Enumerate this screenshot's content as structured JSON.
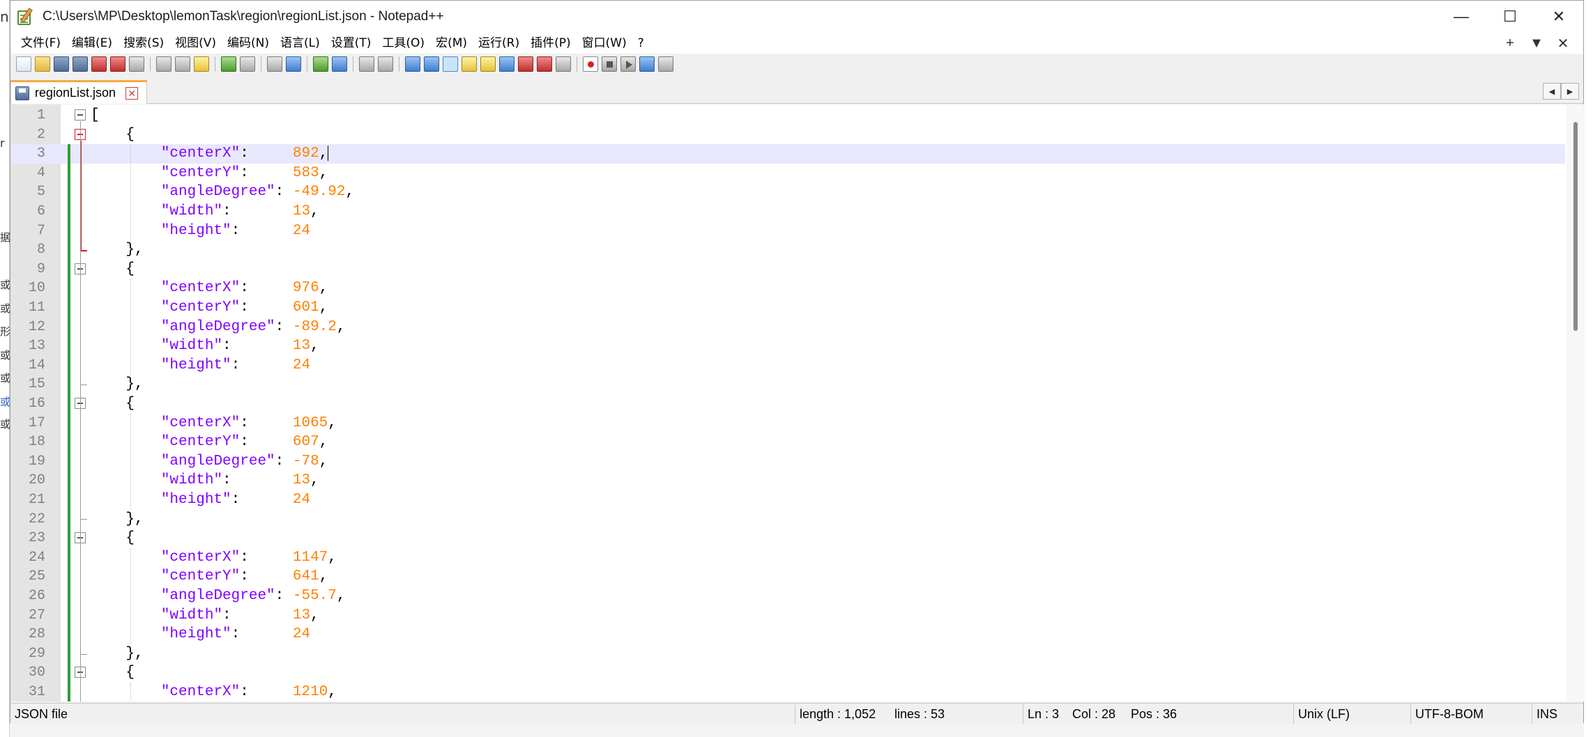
{
  "window": {
    "title": "C:\\Users\\MP\\Desktop\\lemonTask\\region\\regionList.json - Notepad++",
    "controls": {
      "minimize": "—",
      "maximize": "☐",
      "close": "✕"
    }
  },
  "menu": {
    "items": [
      "文件(F)",
      "编辑(E)",
      "搜索(S)",
      "视图(V)",
      "编码(N)",
      "语言(L)",
      "设置(T)",
      "工具(O)",
      "宏(M)",
      "运行(R)",
      "插件(P)",
      "窗口(W)",
      "?"
    ],
    "right": {
      "add": "+",
      "dropdown": "▼",
      "close": "✕"
    }
  },
  "tab": {
    "label": "regionList.json",
    "close": "✕"
  },
  "tab_scroll": {
    "left": "◀",
    "right": "▶"
  },
  "editor": {
    "current_line": 3,
    "lines": [
      {
        "n": "1",
        "tokens": [
          [
            "pun",
            "["
          ]
        ]
      },
      {
        "n": "2",
        "tokens": [
          [
            "pun",
            "    {"
          ]
        ]
      },
      {
        "n": "3",
        "tokens": [
          [
            "pun",
            "        "
          ],
          [
            "key",
            "\"centerX\""
          ],
          [
            "pun",
            ":     "
          ],
          [
            "num",
            "892"
          ],
          [
            "pun",
            ","
          ]
        ]
      },
      {
        "n": "4",
        "tokens": [
          [
            "pun",
            "        "
          ],
          [
            "key",
            "\"centerY\""
          ],
          [
            "pun",
            ":     "
          ],
          [
            "num",
            "583"
          ],
          [
            "pun",
            ","
          ]
        ]
      },
      {
        "n": "5",
        "tokens": [
          [
            "pun",
            "        "
          ],
          [
            "key",
            "\"angleDegree\""
          ],
          [
            "pun",
            ": "
          ],
          [
            "num",
            "-49.92"
          ],
          [
            "pun",
            ","
          ]
        ]
      },
      {
        "n": "6",
        "tokens": [
          [
            "pun",
            "        "
          ],
          [
            "key",
            "\"width\""
          ],
          [
            "pun",
            ":       "
          ],
          [
            "num",
            "13"
          ],
          [
            "pun",
            ","
          ]
        ]
      },
      {
        "n": "7",
        "tokens": [
          [
            "pun",
            "        "
          ],
          [
            "key",
            "\"height\""
          ],
          [
            "pun",
            ":      "
          ],
          [
            "num",
            "24"
          ]
        ]
      },
      {
        "n": "8",
        "tokens": [
          [
            "pun",
            "    },"
          ]
        ]
      },
      {
        "n": "9",
        "tokens": [
          [
            "pun",
            "    {"
          ]
        ]
      },
      {
        "n": "10",
        "tokens": [
          [
            "pun",
            "        "
          ],
          [
            "key",
            "\"centerX\""
          ],
          [
            "pun",
            ":     "
          ],
          [
            "num",
            "976"
          ],
          [
            "pun",
            ","
          ]
        ]
      },
      {
        "n": "11",
        "tokens": [
          [
            "pun",
            "        "
          ],
          [
            "key",
            "\"centerY\""
          ],
          [
            "pun",
            ":     "
          ],
          [
            "num",
            "601"
          ],
          [
            "pun",
            ","
          ]
        ]
      },
      {
        "n": "12",
        "tokens": [
          [
            "pun",
            "        "
          ],
          [
            "key",
            "\"angleDegree\""
          ],
          [
            "pun",
            ": "
          ],
          [
            "num",
            "-89.2"
          ],
          [
            "pun",
            ","
          ]
        ]
      },
      {
        "n": "13",
        "tokens": [
          [
            "pun",
            "        "
          ],
          [
            "key",
            "\"width\""
          ],
          [
            "pun",
            ":       "
          ],
          [
            "num",
            "13"
          ],
          [
            "pun",
            ","
          ]
        ]
      },
      {
        "n": "14",
        "tokens": [
          [
            "pun",
            "        "
          ],
          [
            "key",
            "\"height\""
          ],
          [
            "pun",
            ":      "
          ],
          [
            "num",
            "24"
          ]
        ]
      },
      {
        "n": "15",
        "tokens": [
          [
            "pun",
            "    },"
          ]
        ]
      },
      {
        "n": "16",
        "tokens": [
          [
            "pun",
            "    {"
          ]
        ]
      },
      {
        "n": "17",
        "tokens": [
          [
            "pun",
            "        "
          ],
          [
            "key",
            "\"centerX\""
          ],
          [
            "pun",
            ":     "
          ],
          [
            "num",
            "1065"
          ],
          [
            "pun",
            ","
          ]
        ]
      },
      {
        "n": "18",
        "tokens": [
          [
            "pun",
            "        "
          ],
          [
            "key",
            "\"centerY\""
          ],
          [
            "pun",
            ":     "
          ],
          [
            "num",
            "607"
          ],
          [
            "pun",
            ","
          ]
        ]
      },
      {
        "n": "19",
        "tokens": [
          [
            "pun",
            "        "
          ],
          [
            "key",
            "\"angleDegree\""
          ],
          [
            "pun",
            ": "
          ],
          [
            "num",
            "-78"
          ],
          [
            "pun",
            ","
          ]
        ]
      },
      {
        "n": "20",
        "tokens": [
          [
            "pun",
            "        "
          ],
          [
            "key",
            "\"width\""
          ],
          [
            "pun",
            ":       "
          ],
          [
            "num",
            "13"
          ],
          [
            "pun",
            ","
          ]
        ]
      },
      {
        "n": "21",
        "tokens": [
          [
            "pun",
            "        "
          ],
          [
            "key",
            "\"height\""
          ],
          [
            "pun",
            ":      "
          ],
          [
            "num",
            "24"
          ]
        ]
      },
      {
        "n": "22",
        "tokens": [
          [
            "pun",
            "    },"
          ]
        ]
      },
      {
        "n": "23",
        "tokens": [
          [
            "pun",
            "    {"
          ]
        ]
      },
      {
        "n": "24",
        "tokens": [
          [
            "pun",
            "        "
          ],
          [
            "key",
            "\"centerX\""
          ],
          [
            "pun",
            ":     "
          ],
          [
            "num",
            "1147"
          ],
          [
            "pun",
            ","
          ]
        ]
      },
      {
        "n": "25",
        "tokens": [
          [
            "pun",
            "        "
          ],
          [
            "key",
            "\"centerY\""
          ],
          [
            "pun",
            ":     "
          ],
          [
            "num",
            "641"
          ],
          [
            "pun",
            ","
          ]
        ]
      },
      {
        "n": "26",
        "tokens": [
          [
            "pun",
            "        "
          ],
          [
            "key",
            "\"angleDegree\""
          ],
          [
            "pun",
            ": "
          ],
          [
            "num",
            "-55.7"
          ],
          [
            "pun",
            ","
          ]
        ]
      },
      {
        "n": "27",
        "tokens": [
          [
            "pun",
            "        "
          ],
          [
            "key",
            "\"width\""
          ],
          [
            "pun",
            ":       "
          ],
          [
            "num",
            "13"
          ],
          [
            "pun",
            ","
          ]
        ]
      },
      {
        "n": "28",
        "tokens": [
          [
            "pun",
            "        "
          ],
          [
            "key",
            "\"height\""
          ],
          [
            "pun",
            ":      "
          ],
          [
            "num",
            "24"
          ]
        ]
      },
      {
        "n": "29",
        "tokens": [
          [
            "pun",
            "    },"
          ]
        ]
      },
      {
        "n": "30",
        "tokens": [
          [
            "pun",
            "    {"
          ]
        ]
      },
      {
        "n": "31",
        "tokens": [
          [
            "pun",
            "        "
          ],
          [
            "key",
            "\"centerX\""
          ],
          [
            "pun",
            ":     "
          ],
          [
            "num",
            "1210"
          ],
          [
            "pun",
            ","
          ]
        ]
      }
    ]
  },
  "status": {
    "file_type": "JSON file",
    "length": "length : 1,052",
    "lines": "lines : 53",
    "ln": "Ln : 3",
    "col": "Col : 28",
    "pos": "Pos : 36",
    "eol": "Unix (LF)",
    "encoding": "UTF-8-BOM",
    "mode": "INS"
  },
  "background_glyphs": [
    "n",
    "r",
    "据",
    "或",
    "或",
    "形",
    "或",
    "或",
    "或",
    "或"
  ],
  "colors": {
    "keyword": "#8000ff",
    "number": "#ff8000",
    "current_line": "#e8e8ff",
    "change_bar": "#2e9e33",
    "fold_active": "#d02020",
    "tab_accent": "#f5a742"
  }
}
